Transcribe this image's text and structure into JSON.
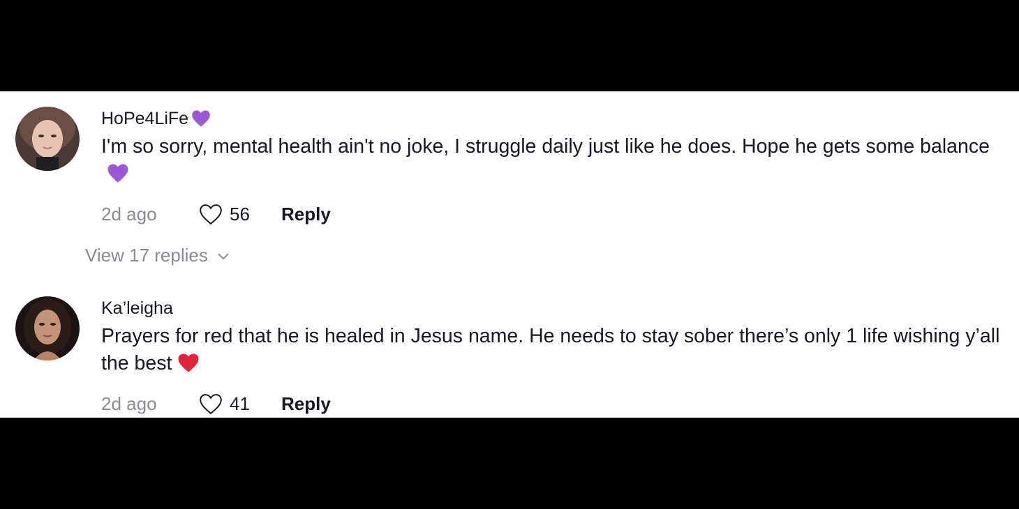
{
  "comments": [
    {
      "username": "HoPe4LiFe",
      "username_emoji": "purple-heart-icon",
      "text": "I'm so sorry, mental health ain't no joke, I struggle daily just like he does. Hope he gets some balance",
      "text_emoji": "purple-heart-icon",
      "time": "2d ago",
      "likes": "56",
      "reply_label": "Reply"
    },
    {
      "username": "Ka’leigha",
      "text": "Prayers for red that he is healed in Jesus name. He needs to stay sober there’s only 1 life wishing y’all the best",
      "text_emoji": "red-heart-icon",
      "time": "2d ago",
      "likes": "41",
      "reply_label": "Reply"
    }
  ],
  "view_replies": {
    "label": "View 17 replies",
    "icon": "chevron-down-icon"
  },
  "colors": {
    "background": "#000000",
    "panel": "#ffffff",
    "text_primary": "#161823",
    "text_secondary": "#8a8b91",
    "purple_heart": "#9b59d6",
    "red_heart": "#e0243b"
  }
}
